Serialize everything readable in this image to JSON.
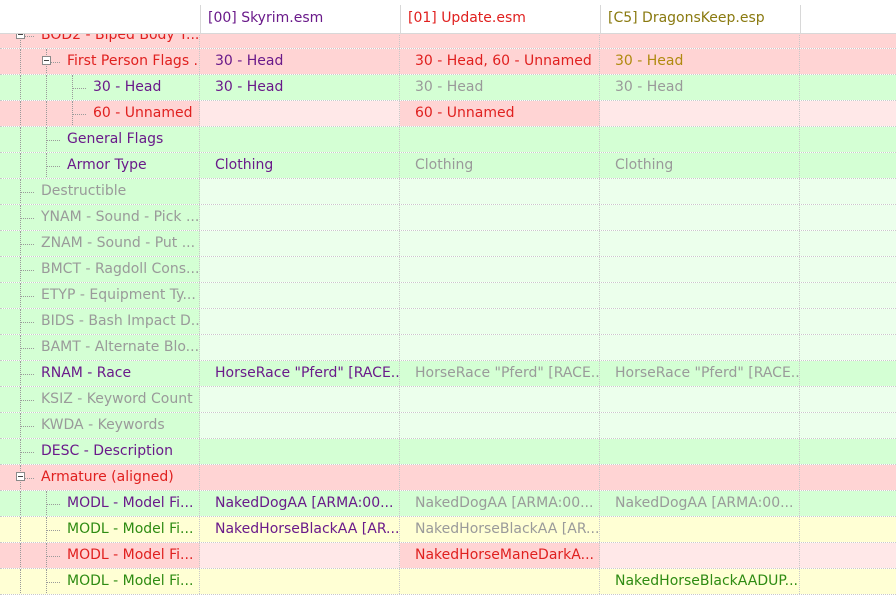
{
  "header": {
    "plugins": [
      {
        "label": "[00] Skyrim.esm",
        "color": "#6a1a8a"
      },
      {
        "label": "[01] Update.esm",
        "color": "#e0201f"
      },
      {
        "label": "[C5] DragonsKeep.esp",
        "color": "#8a7a10"
      }
    ]
  },
  "rows": [
    {
      "label": "BOD2 - Biped Body T...",
      "cells": [
        "",
        "",
        ""
      ]
    },
    {
      "label": "First Person Flags ...",
      "cells": [
        "30 - Head",
        "30 - Head, 60 - Unnamed",
        "30 - Head"
      ]
    },
    {
      "label": "30 - Head",
      "cells": [
        "30 - Head",
        "30 - Head",
        "30 - Head"
      ]
    },
    {
      "label": "60 - Unnamed",
      "cells": [
        "",
        "60 - Unnamed",
        ""
      ]
    },
    {
      "label": "General Flags",
      "cells": [
        "",
        "",
        ""
      ]
    },
    {
      "label": "Armor Type",
      "cells": [
        "Clothing",
        "Clothing",
        "Clothing"
      ]
    },
    {
      "label": "Destructible",
      "cells": [
        "",
        "",
        ""
      ]
    },
    {
      "label": "YNAM - Sound - Pick ...",
      "cells": [
        "",
        "",
        ""
      ]
    },
    {
      "label": "ZNAM - Sound - Put ...",
      "cells": [
        "",
        "",
        ""
      ]
    },
    {
      "label": "BMCT - Ragdoll Cons...",
      "cells": [
        "",
        "",
        ""
      ]
    },
    {
      "label": "ETYP - Equipment Ty...",
      "cells": [
        "",
        "",
        ""
      ]
    },
    {
      "label": "BIDS - Bash Impact D...",
      "cells": [
        "",
        "",
        ""
      ]
    },
    {
      "label": "BAMT - Alternate Blo...",
      "cells": [
        "",
        "",
        ""
      ]
    },
    {
      "label": "RNAM - Race",
      "cells": [
        "HorseRace \"Pferd\" [RACE...",
        "HorseRace \"Pferd\" [RACE...",
        "HorseRace \"Pferd\" [RACE..."
      ]
    },
    {
      "label": "KSIZ - Keyword Count",
      "cells": [
        "",
        "",
        ""
      ]
    },
    {
      "label": "KWDA - Keywords",
      "cells": [
        "",
        "",
        ""
      ]
    },
    {
      "label": "DESC - Description",
      "cells": [
        "",
        "",
        ""
      ]
    },
    {
      "label": "Armature (aligned)",
      "cells": [
        "",
        "",
        ""
      ]
    },
    {
      "label": "MODL - Model Fi...",
      "cells": [
        "NakedDogAA [ARMA:00...",
        "NakedDogAA [ARMA:00...",
        "NakedDogAA [ARMA:00..."
      ]
    },
    {
      "label": "MODL - Model Fi...",
      "cells": [
        "NakedHorseBlackAA [AR...",
        "NakedHorseBlackAA [AR...",
        ""
      ]
    },
    {
      "label": "MODL - Model Fi...",
      "cells": [
        "",
        "NakedHorseManeDarkA...",
        ""
      ]
    },
    {
      "label": "MODL - Model Fi...",
      "cells": [
        "",
        "",
        "NakedHorseBlackAADUP..."
      ]
    }
  ],
  "colors": {
    "conflict_bg": "#ffd4d4",
    "conflict_bg_light": "#ffe8e8",
    "ok_bg": "#d4ffd4",
    "ok_bg_light": "#ecffec",
    "override_bg": "#ffffd4"
  }
}
